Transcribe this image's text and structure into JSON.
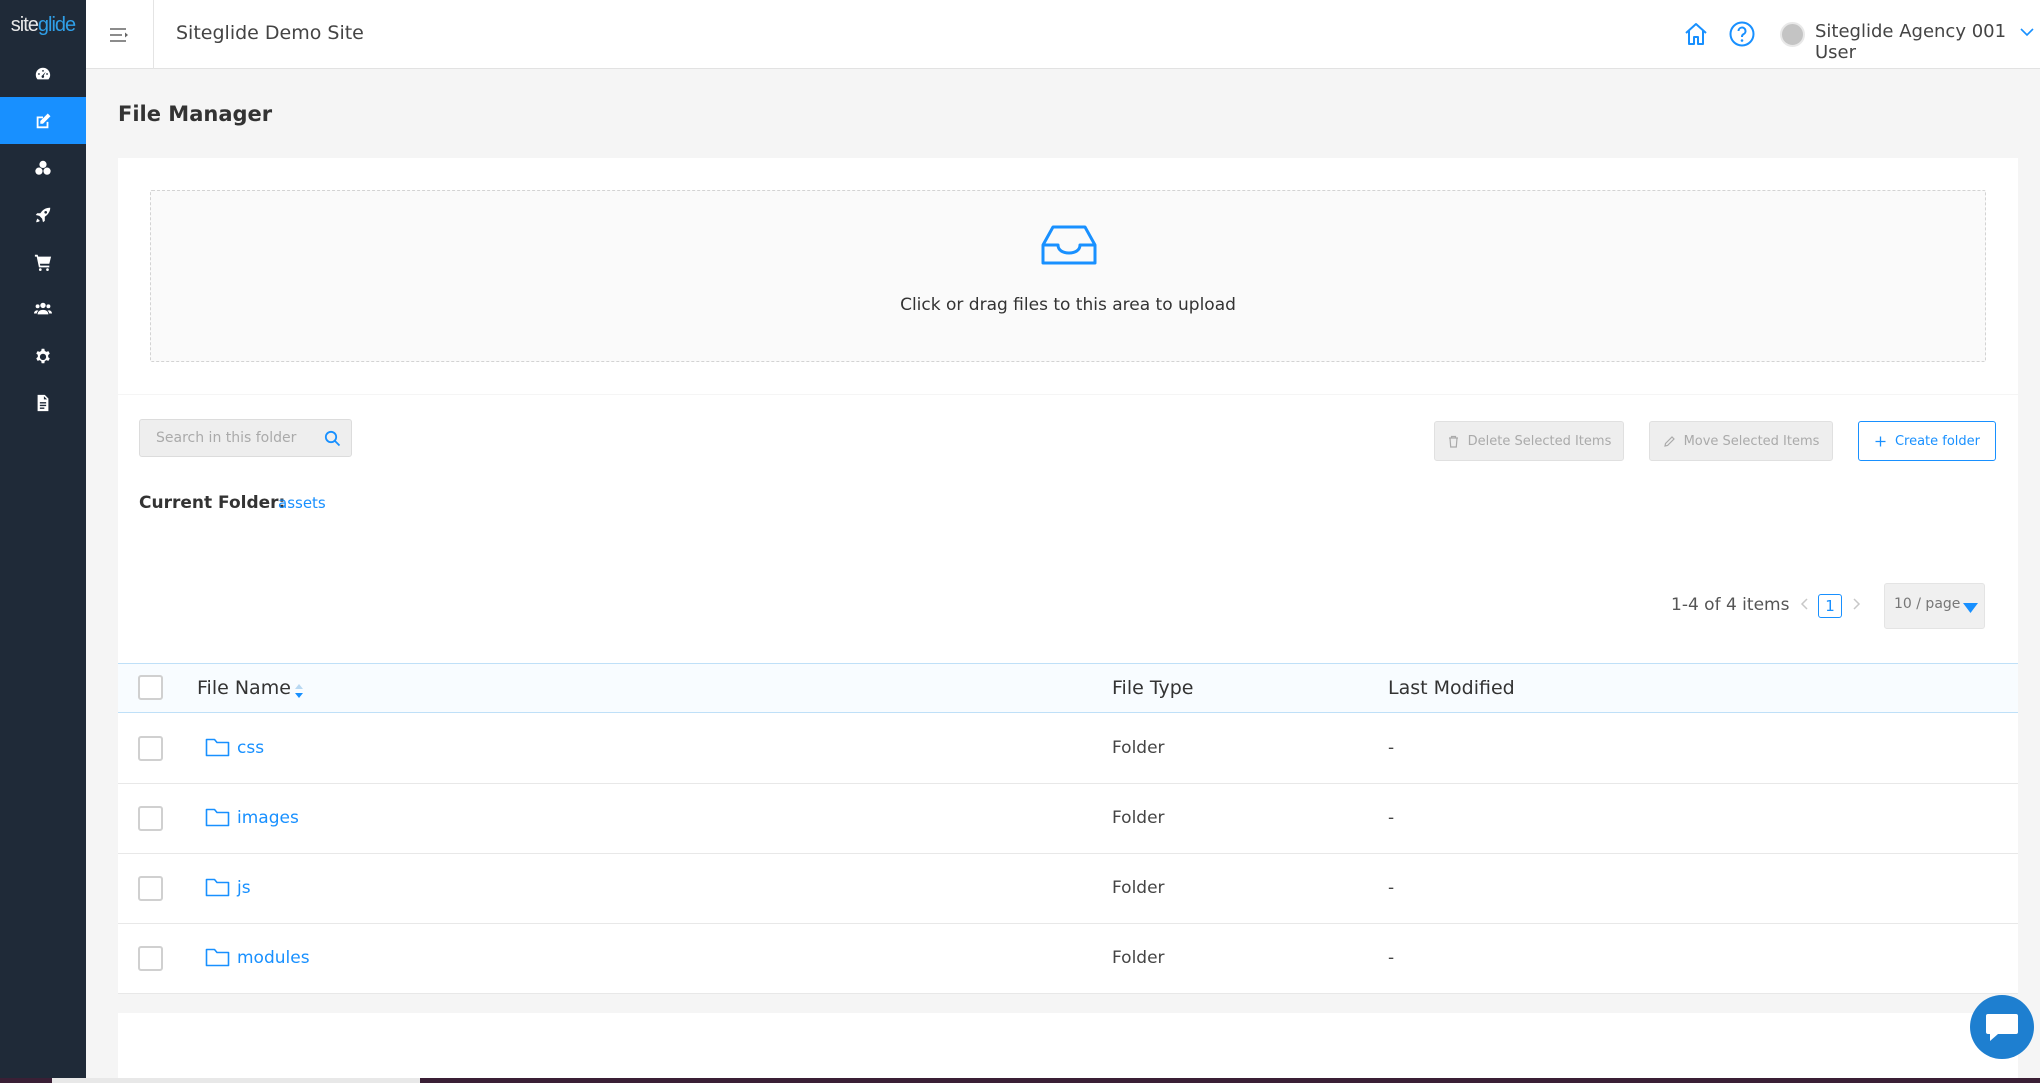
{
  "brand": {
    "logo_text_a": "site",
    "logo_text_b": "glide",
    "accent_color": "#1890ff"
  },
  "sidebar": {
    "items": [
      {
        "icon": "dashboard-icon"
      },
      {
        "icon": "edit-icon",
        "active": true
      },
      {
        "icon": "modules-icon"
      },
      {
        "icon": "rocket-icon"
      },
      {
        "icon": "cart-icon"
      },
      {
        "icon": "users-icon"
      },
      {
        "icon": "gear-icon"
      },
      {
        "icon": "document-icon"
      }
    ]
  },
  "header": {
    "site_title": "Siteglide Demo Site",
    "user_name": "Siteglide Agency 001 User"
  },
  "page": {
    "title": "File Manager"
  },
  "upload": {
    "text": "Click or drag files to this area to upload"
  },
  "toolbar": {
    "search_placeholder": "Search in this folder",
    "delete_label": "Delete Selected Items",
    "move_label": "Move Selected Items",
    "create_label": "Create folder"
  },
  "current_folder": {
    "label": "Current Folder:",
    "value": "assets"
  },
  "pagination": {
    "info": "1-4 of 4 items",
    "current_page": "1",
    "page_size": "10 / page"
  },
  "table": {
    "columns": [
      "File Name",
      "File Type",
      "Last Modified"
    ],
    "rows": [
      {
        "name": "css",
        "type": "Folder",
        "modified": "-"
      },
      {
        "name": "images",
        "type": "Folder",
        "modified": "-"
      },
      {
        "name": "js",
        "type": "Folder",
        "modified": "-"
      },
      {
        "name": "modules",
        "type": "Folder",
        "modified": "-"
      }
    ]
  }
}
